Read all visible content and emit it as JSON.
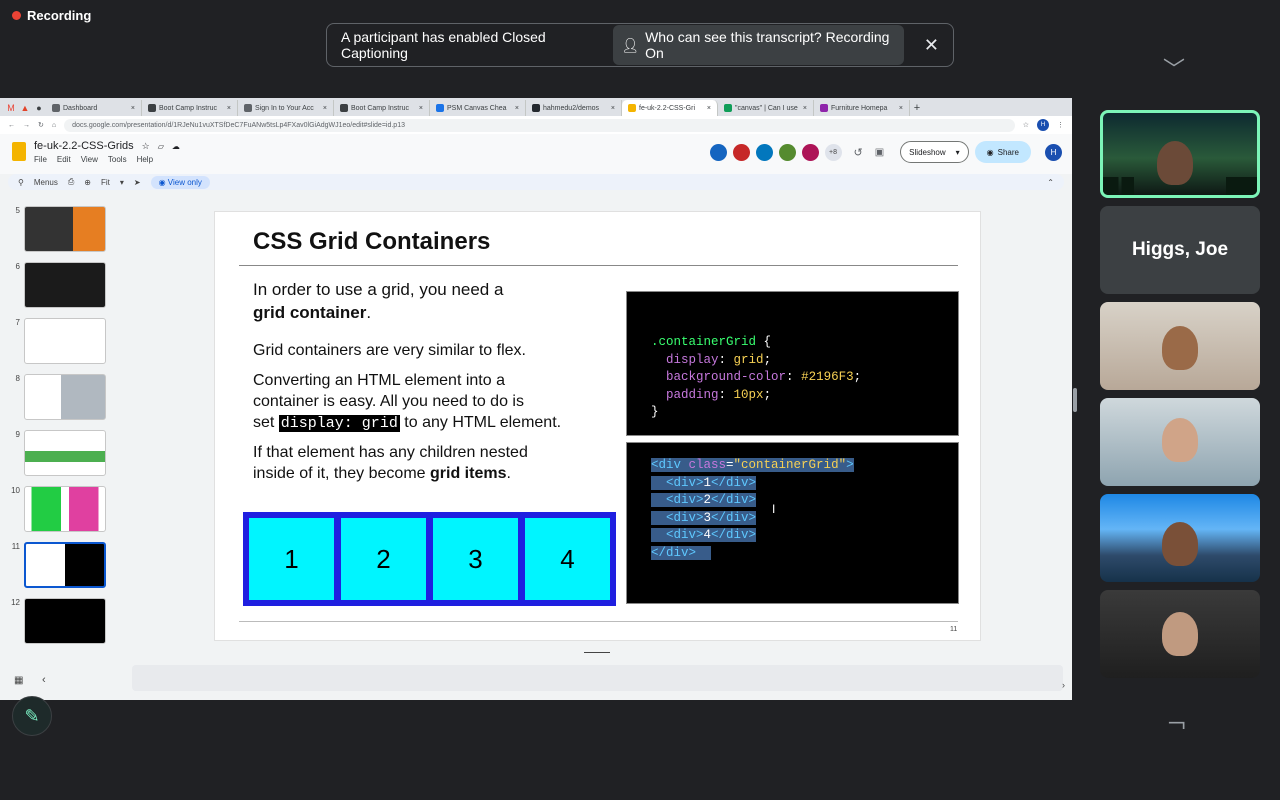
{
  "meeting": {
    "recording_label": "Recording",
    "cc_message": "A participant has enabled Closed Captioning",
    "cc_link": "Who can see this transcript? Recording On",
    "participants": [
      {
        "name": ""
      },
      {
        "name": "Higgs, Joe"
      },
      {
        "name": ""
      },
      {
        "name": ""
      },
      {
        "name": ""
      },
      {
        "name": ""
      }
    ]
  },
  "browser": {
    "tabs": [
      {
        "label": "Dashboard",
        "color": "#5f6368"
      },
      {
        "label": "Boot Camp Instruc",
        "color": "#3c4043"
      },
      {
        "label": "Sign In to Your Acc",
        "color": "#5f6368"
      },
      {
        "label": "Boot Camp Instruc",
        "color": "#3c4043"
      },
      {
        "label": "PSM Canvas Chea",
        "color": "#1a73e8"
      },
      {
        "label": "hahmedu2/demos",
        "color": "#24292f"
      },
      {
        "label": "fe-uk-2.2-CSS-Gri",
        "color": "#f4b400"
      },
      {
        "label": "\"canvas\" | Can I use",
        "color": "#0f9d58"
      },
      {
        "label": "Furniture Homepa",
        "color": "#8e24aa"
      }
    ],
    "active_tab_index": 6,
    "url": "docs.google.com/presentation/d/1RJeNu1vuXTSfDeC7FuANw5tsLp4FXav0lGiAdgWJ1eo/edit#slide=id.p13"
  },
  "doc": {
    "title": "fe-uk-2.2-CSS-Grids",
    "menus": [
      "File",
      "Edit",
      "View",
      "Tools",
      "Help"
    ],
    "collab_count": "+8",
    "slideshow_label": "Slideshow",
    "share_label": "Share",
    "user_initial": "H",
    "toolbar": {
      "menus": "Menus",
      "zoom": "Fit",
      "view_only": "View only"
    }
  },
  "thumbnails": [
    {
      "num": "5"
    },
    {
      "num": "6"
    },
    {
      "num": "7"
    },
    {
      "num": "8"
    },
    {
      "num": "9"
    },
    {
      "num": "10"
    },
    {
      "num": "11"
    },
    {
      "num": "12"
    }
  ],
  "selected_thumbnail": "11",
  "slide": {
    "title": "CSS Grid Containers",
    "p1_a": "In order to use a grid, you need a",
    "p1_b": "grid container",
    "p1_c": ".",
    "p2": "Grid containers are very similar to flex.",
    "p3_a": "Converting an HTML element into a",
    "p3_b": "container is easy. All you need to do is",
    "p3_c": "set",
    "p3_code": "display: grid",
    "p3_d": "to any HTML element.",
    "p4_a": "If that element has any children nested",
    "p4_b": "inside of it, they become",
    "p4_c": "grid items",
    "p4_d": ".",
    "grid_items": [
      "1",
      "2",
      "3",
      "4"
    ],
    "css_lines": [
      {
        "sel": ".containerGrid",
        "rest": " {"
      },
      {
        "prop": "display",
        "val": "grid"
      },
      {
        "prop": "background-color",
        "val": "#2196F3"
      },
      {
        "prop": "padding",
        "val": "10px"
      },
      {
        "close": "}"
      }
    ],
    "html_lines": [
      {
        "t1": "<div ",
        "attr": "class",
        "eq": "=",
        "str": "\"containerGrid\"",
        "t2": ">"
      },
      {
        "t1": "  <div>",
        "txt": "1",
        "t2": "</div>"
      },
      {
        "t1": "  <div>",
        "txt": "2",
        "t2": "</div>"
      },
      {
        "t1": "  <div>",
        "txt": "3",
        "t2": "</div>"
      },
      {
        "t1": "  <div>",
        "txt": "4",
        "t2": "</div>"
      },
      {
        "t1": "</div>",
        "txt": "",
        "t2": ""
      }
    ],
    "page_number": "11"
  },
  "colors": {
    "selector": "#39ff70",
    "property": "#c678dd",
    "value": "#f7d154",
    "tag": "#5ec8ff",
    "string": "#f7d154"
  }
}
